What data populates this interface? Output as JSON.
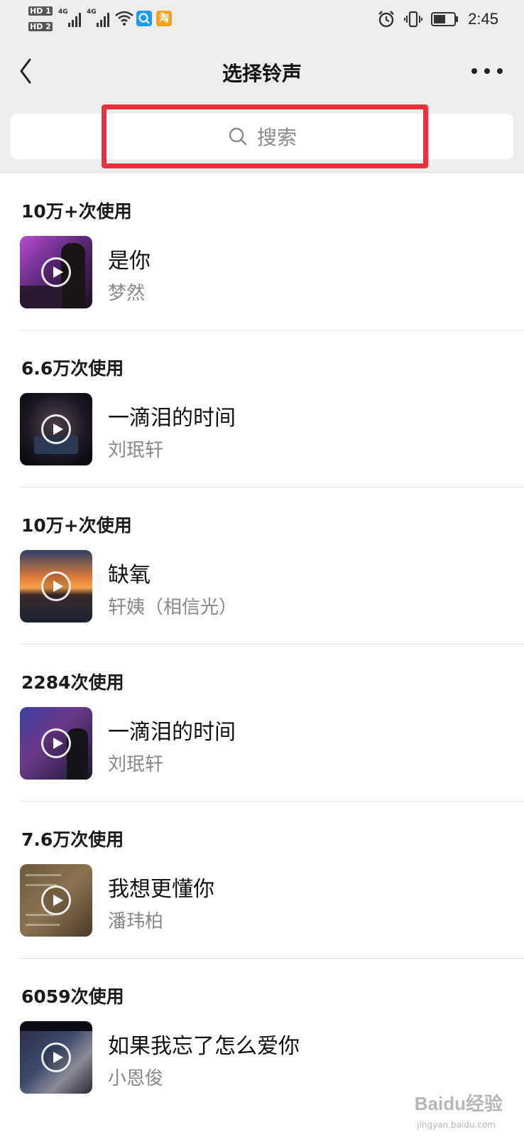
{
  "status_bar": {
    "hd1": "HD 1",
    "hd2": "HD 2",
    "net1": "4G",
    "net2": "4G",
    "app_icon_1": "search-app-icon",
    "app_icon_2": "淘",
    "time": "2:45"
  },
  "nav": {
    "title": "选择铃声"
  },
  "search": {
    "placeholder": "搜索"
  },
  "colors": {
    "header_bg": "#ededed",
    "highlight": "#e8313f"
  },
  "ringtones": [
    {
      "usage": "10万+次使用",
      "song": "是你",
      "artist": "梦然"
    },
    {
      "usage": "6.6万次使用",
      "song": "一滴泪的时间",
      "artist": "刘珉轩"
    },
    {
      "usage": "10万+次使用",
      "song": "缺氧",
      "artist": "轩姨（相信光）"
    },
    {
      "usage": "2284次使用",
      "song": "一滴泪的时间",
      "artist": "刘珉轩"
    },
    {
      "usage": "7.6万次使用",
      "song": "我想更懂你",
      "artist": "潘玮柏"
    },
    {
      "usage": "6059次使用",
      "song": "如果我忘了怎么爱你",
      "artist": "小恩俊"
    }
  ],
  "watermark": {
    "brand": "Baidu经验",
    "url": "jingyan.baidu.com"
  }
}
